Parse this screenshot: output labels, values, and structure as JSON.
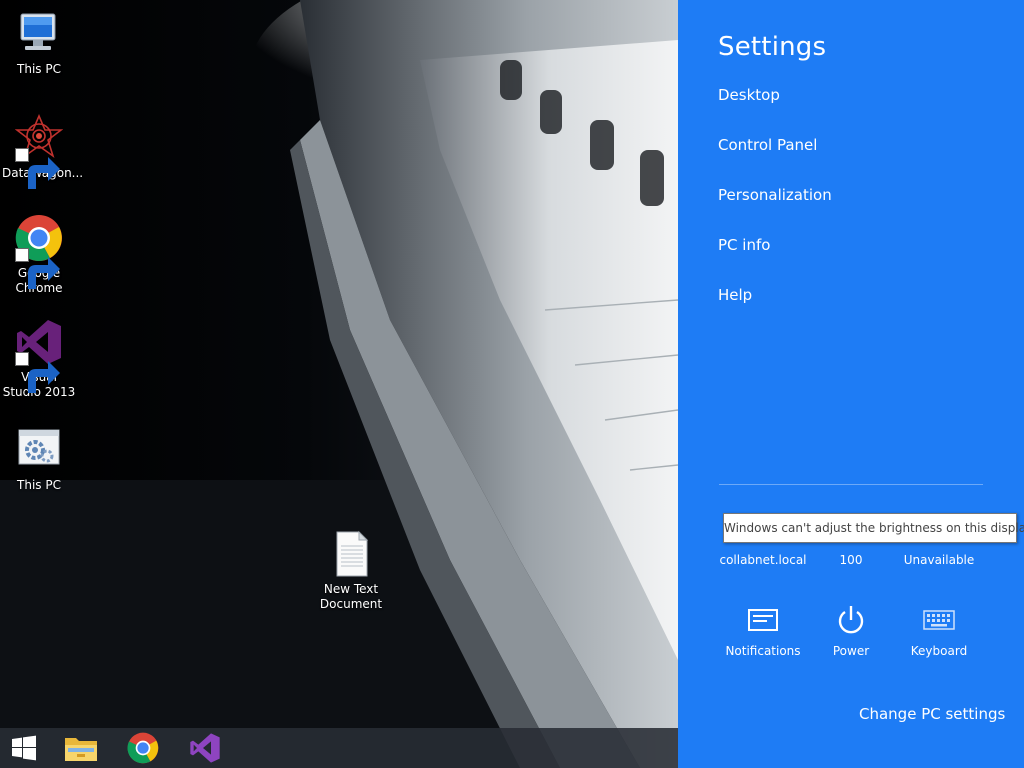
{
  "desktop": {
    "icons": [
      {
        "label": "This PC",
        "icon": "computer-icon"
      },
      {
        "label": "DataWagon...",
        "icon": "datawagon-icon"
      },
      {
        "label": "Google Chrome",
        "icon": "chrome-icon"
      },
      {
        "label": "Visual Studio 2013",
        "icon": "visual-studio-icon"
      },
      {
        "label": "This PC",
        "icon": "system-settings-icon"
      },
      {
        "label": "New Text Document",
        "icon": "text-document-icon"
      }
    ]
  },
  "taskbar": {
    "items": [
      {
        "icon": "windows-start-icon"
      },
      {
        "icon": "file-explorer-icon"
      },
      {
        "icon": "chrome-icon"
      },
      {
        "icon": "visual-studio-icon"
      }
    ]
  },
  "settings_charm": {
    "title": "Settings",
    "links": [
      "Desktop",
      "Control Panel",
      "Personalization",
      "PC info",
      "Help"
    ],
    "tooltip": "Windows can't adjust the brightness on this display",
    "status_values": [
      "collabnet.local",
      "100",
      "Unavailable"
    ],
    "tiles": [
      {
        "label": "Notifications",
        "icon": "notifications-icon"
      },
      {
        "label": "Power",
        "icon": "power-icon"
      },
      {
        "label": "Keyboard",
        "icon": "keyboard-icon"
      }
    ],
    "change_settings": "Change PC settings",
    "colors": {
      "accent": "#1e7cf5",
      "taskbar": "#282c34"
    }
  }
}
